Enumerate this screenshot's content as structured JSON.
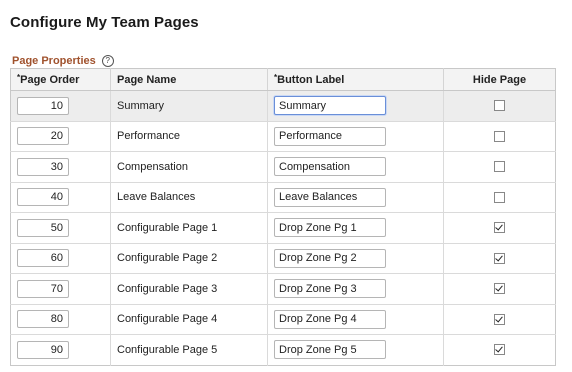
{
  "page_title": "Configure My Team Pages",
  "section": {
    "title": "Page Properties",
    "help_icon": "?"
  },
  "columns": {
    "required_marker": "*",
    "page_order": "Page Order",
    "page_name": "Page Name",
    "button_label": "Button Label",
    "hide_page": "Hide Page"
  },
  "rows": [
    {
      "order": "10",
      "name": "Summary",
      "label": "Summary",
      "hide": false
    },
    {
      "order": "20",
      "name": "Performance",
      "label": "Performance",
      "hide": false
    },
    {
      "order": "30",
      "name": "Compensation",
      "label": "Compensation",
      "hide": false
    },
    {
      "order": "40",
      "name": "Leave Balances",
      "label": "Leave Balances",
      "hide": false
    },
    {
      "order": "50",
      "name": "Configurable Page 1",
      "label": "Drop Zone Pg 1",
      "hide": true
    },
    {
      "order": "60",
      "name": "Configurable Page 2",
      "label": "Drop Zone Pg 2",
      "hide": true
    },
    {
      "order": "70",
      "name": "Configurable Page 3",
      "label": "Drop Zone Pg 3",
      "hide": true
    },
    {
      "order": "80",
      "name": "Configurable Page 4",
      "label": "Drop Zone Pg 4",
      "hide": true
    },
    {
      "order": "90",
      "name": "Configurable Page 5",
      "label": "Drop Zone Pg 5",
      "hide": true
    }
  ],
  "colors": {
    "section_title": "#a0522d",
    "focus_border": "#6a8fd8"
  }
}
